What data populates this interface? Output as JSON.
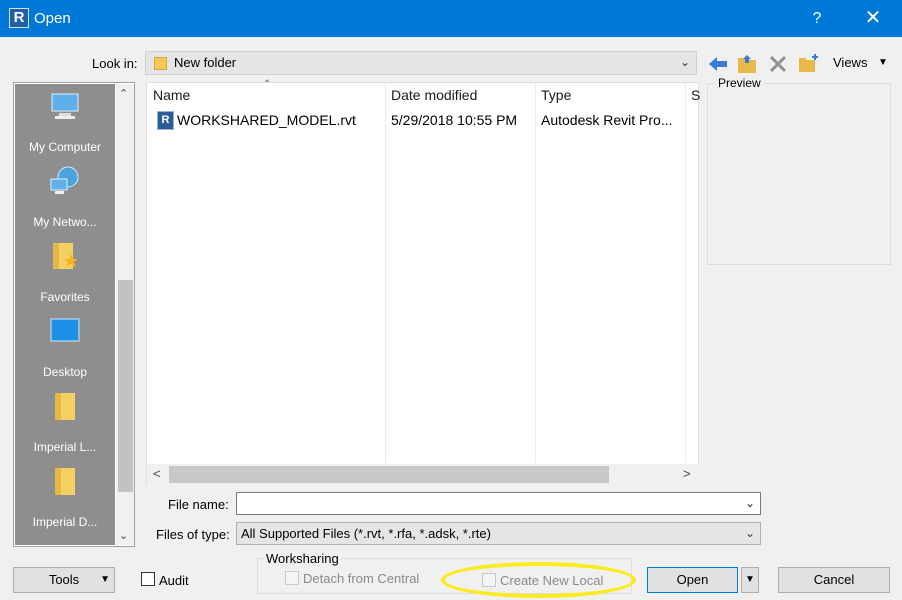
{
  "window": {
    "title": "Open",
    "app_icon_letter": "R",
    "help": "?",
    "close": "✕"
  },
  "toolbar": {
    "look_in_label": "Look in:",
    "look_in_value": "New folder",
    "views_label": "Views"
  },
  "places": [
    {
      "label": "My Computer"
    },
    {
      "label": "My Netwo..."
    },
    {
      "label": "Favorites"
    },
    {
      "label": "Desktop"
    },
    {
      "label": "Imperial L..."
    },
    {
      "label": "Imperial D..."
    }
  ],
  "filelist": {
    "columns": [
      "Name",
      "Date modified",
      "Type",
      "S"
    ],
    "rows": [
      {
        "name": "WORKSHARED_MODEL.rvt",
        "date": "5/29/2018 10:55 PM",
        "type": "Autodesk Revit Pro..."
      }
    ]
  },
  "preview_label": "Preview",
  "file_name": {
    "label": "File name:",
    "value": ""
  },
  "file_type": {
    "label": "Files of type:",
    "value": "All Supported Files  (*.rvt, *.rfa, *.adsk, *.rte)"
  },
  "worksharing": {
    "label": "Worksharing",
    "detach_label": "Detach from Central",
    "create_local_label": "Create New Local"
  },
  "buttons": {
    "tools": "Tools",
    "audit": "Audit",
    "open": "Open",
    "cancel": "Cancel"
  },
  "colors": {
    "titlebar": "#0078d7",
    "highlight": "#f8ec1e",
    "places_bg": "#8e8e8e"
  }
}
